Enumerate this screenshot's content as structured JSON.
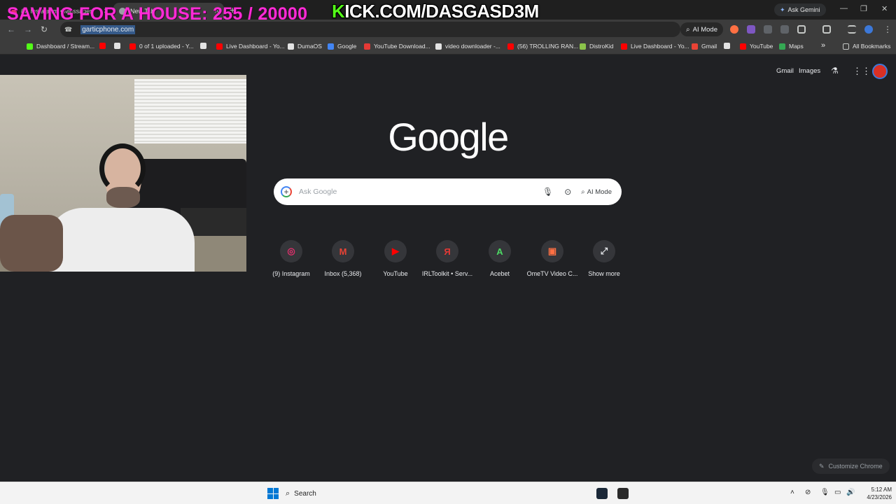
{
  "overlay": {
    "title": "SAVING FOR A HOUSE: 255 / 20000"
  },
  "tabs": [
    {
      "title": "(9) Instagram • Messages",
      "favicon": "instagram-icon"
    },
    {
      "title": "New Tab",
      "favicon": "chrome-icon",
      "active": true
    }
  ],
  "titlebar": {
    "ask_gemini": "Ask Gemini"
  },
  "toolbar": {
    "url": "garticphone.com",
    "ai_mode": "AI Mode"
  },
  "bookmarks": [
    {
      "label": "Dashboard / Stream...",
      "color": "#53fc18"
    },
    {
      "label": "",
      "color": "#ff0000"
    },
    {
      "label": "",
      "color": "#e3e3e3"
    },
    {
      "label": "0 of 1 uploaded - Y...",
      "color": "#ff0000"
    },
    {
      "label": "",
      "color": "#e3e3e3"
    },
    {
      "label": "Live Dashboard - Yo...",
      "color": "#ff0000"
    },
    {
      "label": "DumaOS",
      "color": "#e3e3e3"
    },
    {
      "label": "Google",
      "color": "#4285f4"
    },
    {
      "label": "YouTube Download...",
      "color": "#e53935"
    },
    {
      "label": "video downloader -...",
      "color": "#e3e3e3"
    },
    {
      "label": "(56) TROLLING RAN...",
      "color": "#ff0000"
    },
    {
      "label": "DistroKid",
      "color": "#8bc34a"
    },
    {
      "label": "Live Dashboard - Yo...",
      "color": "#ff0000"
    },
    {
      "label": "Gmail",
      "color": "#ea4335"
    },
    {
      "label": "",
      "color": "#e3e3e3"
    },
    {
      "label": "YouTube",
      "color": "#ff0000"
    },
    {
      "label": "Maps",
      "color": "#34a853"
    }
  ],
  "all_bookmarks": "All Bookmarks",
  "header_links": {
    "gmail": "Gmail",
    "images": "Images"
  },
  "google": {
    "logo": "Google",
    "search_placeholder": "Ask Google",
    "ai_mode": "AI Mode"
  },
  "shortcuts": [
    {
      "label": "(9) Instagram",
      "glyph": "◎",
      "color": "#e1306c"
    },
    {
      "label": "Inbox (5,368)",
      "glyph": "M",
      "color": "#ea4335"
    },
    {
      "label": "YouTube",
      "glyph": "▶",
      "color": "#ff0000"
    },
    {
      "label": "IRLToolkit • Serv...",
      "glyph": "Я",
      "color": "#e53935"
    },
    {
      "label": "Acebet",
      "glyph": "A",
      "color": "#4cd964"
    },
    {
      "label": "OmeTV Video C...",
      "glyph": "▣",
      "color": "#ff7043"
    },
    {
      "label": "Show more",
      "glyph": "⤢",
      "color": "#e8eaed"
    }
  ],
  "customize": "Customize Chrome",
  "taskbar": {
    "search": "Search",
    "kick_prefix": "K",
    "kick_rest": "ICK.COM/DASGASD3M",
    "time": "5:12 AM",
    "date": "4/23/2026"
  }
}
